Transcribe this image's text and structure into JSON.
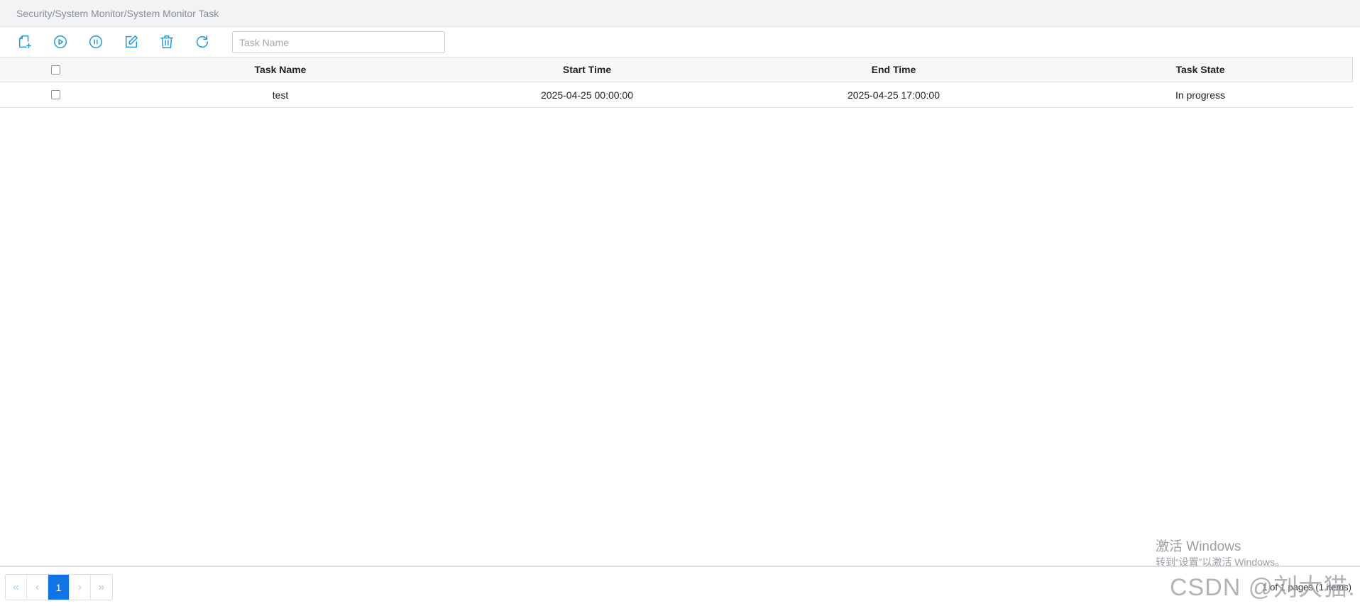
{
  "breadcrumb": "Security/System Monitor/System Monitor Task",
  "toolbar": {
    "buttons": [
      {
        "name": "add-task-button",
        "icon": "add-file-icon"
      },
      {
        "name": "start-task-button",
        "icon": "play-circle-icon"
      },
      {
        "name": "pause-task-button",
        "icon": "pause-circle-icon"
      },
      {
        "name": "edit-task-button",
        "icon": "edit-icon"
      },
      {
        "name": "delete-task-button",
        "icon": "trash-icon"
      },
      {
        "name": "refresh-button",
        "icon": "refresh-icon"
      }
    ],
    "search": {
      "placeholder": "Task Name",
      "value": ""
    }
  },
  "table": {
    "columns": [
      "Task Name",
      "Start Time",
      "End Time",
      "Task State"
    ],
    "rows": [
      {
        "task_name": "test",
        "start_time": "2025-04-25 00:00:00",
        "end_time": "2025-04-25 17:00:00",
        "task_state": "In progress"
      }
    ]
  },
  "pagination": {
    "first": "«",
    "prev": "‹",
    "current_page": "1",
    "next": "›",
    "last": "»",
    "info": "1 of 1 pages (1 items)"
  },
  "watermarks": {
    "windows_line1": "激活 Windows",
    "windows_line2": "转到“设置”以激活 Windows。",
    "csdn": "CSDN @刘大猫."
  },
  "colors": {
    "accent": "#1a9ad6",
    "active_page": "#1174e6"
  }
}
